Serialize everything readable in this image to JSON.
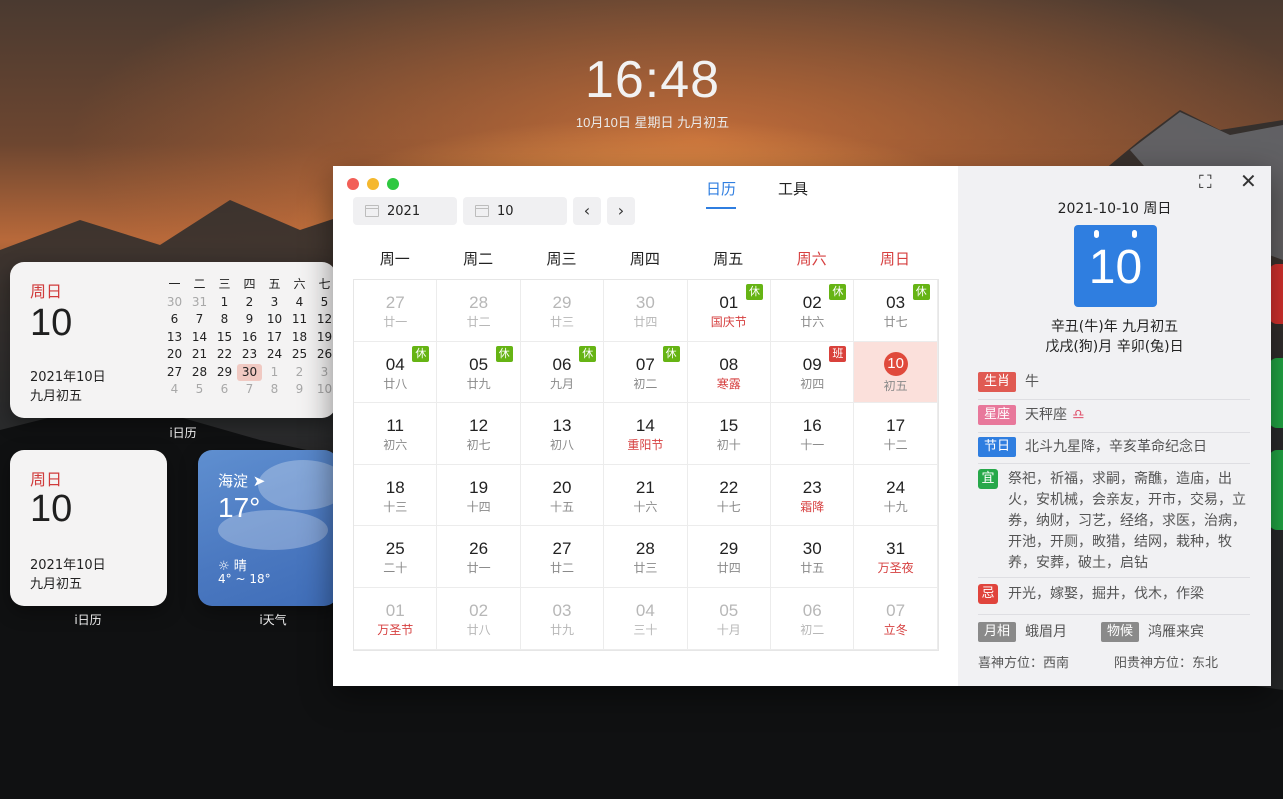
{
  "lockscreen": {
    "time": "16:48",
    "date": "10月10日 星期日 九月初五"
  },
  "widget_big": {
    "dow": "周日",
    "day": "10",
    "ymd": "2021年10日",
    "lunar": "九月初五",
    "label": "i日历",
    "weekdays": [
      "一",
      "二",
      "三",
      "四",
      "五",
      "六",
      "七"
    ],
    "rows": [
      [
        "30",
        "31",
        "1",
        "2",
        "3",
        "4",
        "5"
      ],
      [
        "6",
        "7",
        "8",
        "9",
        "10",
        "11",
        "12"
      ],
      [
        "13",
        "14",
        "15",
        "16",
        "17",
        "18",
        "19"
      ],
      [
        "20",
        "21",
        "22",
        "23",
        "24",
        "25",
        "26"
      ],
      [
        "27",
        "28",
        "29",
        "30",
        "1",
        "2",
        "3"
      ],
      [
        "4",
        "5",
        "6",
        "7",
        "8",
        "9",
        "10"
      ]
    ]
  },
  "widget_small": {
    "dow": "周日",
    "day": "10",
    "ymd": "2021年10日",
    "lunar": "九月初五",
    "label": "i日历"
  },
  "weather": {
    "location": "海淀",
    "temp": "17°",
    "condition": "☼ 晴",
    "range": "4° ~ 18°",
    "label": "i天气"
  },
  "window": {
    "year": "2021",
    "month": "10",
    "tabs": [
      "日历",
      "工具"
    ],
    "weekdays": [
      "周一",
      "周二",
      "周三",
      "周四",
      "周五",
      "周六",
      "周日"
    ],
    "cells": [
      {
        "n": "27",
        "l": "廿一",
        "dim": true
      },
      {
        "n": "28",
        "l": "廿二",
        "dim": true
      },
      {
        "n": "29",
        "l": "廿三",
        "dim": true
      },
      {
        "n": "30",
        "l": "廿四",
        "dim": true
      },
      {
        "n": "01",
        "l": "国庆节",
        "fest": true,
        "badge": "休"
      },
      {
        "n": "02",
        "l": "廿六",
        "badge": "休"
      },
      {
        "n": "03",
        "l": "廿七",
        "badge": "休"
      },
      {
        "n": "04",
        "l": "廿八",
        "badge": "休"
      },
      {
        "n": "05",
        "l": "廿九",
        "badge": "休"
      },
      {
        "n": "06",
        "l": "九月",
        "badge": "休"
      },
      {
        "n": "07",
        "l": "初二",
        "badge": "休"
      },
      {
        "n": "08",
        "l": "寒露",
        "fest": true
      },
      {
        "n": "09",
        "l": "初四",
        "badge": "班",
        "work": true
      },
      {
        "n": "10",
        "l": "初五",
        "today": true
      },
      {
        "n": "11",
        "l": "初六"
      },
      {
        "n": "12",
        "l": "初七"
      },
      {
        "n": "13",
        "l": "初八"
      },
      {
        "n": "14",
        "l": "重阳节",
        "fest": true
      },
      {
        "n": "15",
        "l": "初十"
      },
      {
        "n": "16",
        "l": "十一"
      },
      {
        "n": "17",
        "l": "十二"
      },
      {
        "n": "18",
        "l": "十三"
      },
      {
        "n": "19",
        "l": "十四"
      },
      {
        "n": "20",
        "l": "十五"
      },
      {
        "n": "21",
        "l": "十六"
      },
      {
        "n": "22",
        "l": "十七"
      },
      {
        "n": "23",
        "l": "霜降",
        "fest": true
      },
      {
        "n": "24",
        "l": "十九"
      },
      {
        "n": "25",
        "l": "二十"
      },
      {
        "n": "26",
        "l": "廿一"
      },
      {
        "n": "27",
        "l": "廿二"
      },
      {
        "n": "28",
        "l": "廿三"
      },
      {
        "n": "29",
        "l": "廿四"
      },
      {
        "n": "30",
        "l": "廿五"
      },
      {
        "n": "31",
        "l": "万圣夜",
        "fest": true
      },
      {
        "n": "01",
        "l": "万圣节",
        "fest": true,
        "dim": true
      },
      {
        "n": "02",
        "l": "廿八",
        "dim": true
      },
      {
        "n": "03",
        "l": "廿九",
        "dim": true
      },
      {
        "n": "04",
        "l": "三十",
        "dim": true
      },
      {
        "n": "05",
        "l": "十月",
        "dim": true
      },
      {
        "n": "06",
        "l": "初二",
        "dim": true
      },
      {
        "n": "07",
        "l": "立冬",
        "fest": true,
        "dim": true
      }
    ]
  },
  "panel": {
    "date": "2021-10-10 周日",
    "big_day": "10",
    "ganzhi1": "辛丑(牛)年 九月初五",
    "ganzhi2": "戊戌(狗)月 辛卯(兔)日",
    "zodiac_label": "生肖",
    "zodiac": "牛",
    "star_label": "星座",
    "star": "天秤座",
    "star_symbol": "♎",
    "holiday_label": "节日",
    "holiday": "北斗九星降，辛亥革命纪念日",
    "yi_label": "宜",
    "yi": "祭祀，祈福，求嗣，斋醮，造庙，出火，安机械，会亲友，开市，交易，立券，纳财，习艺，经络，求医，治病，开池，开厕，畋猎，结网，栽种，牧养，安葬，破土，启钻",
    "ji_label": "忌",
    "ji": "开光，嫁娶，掘井，伐木，作梁",
    "moon_label": "月相",
    "moon": "蛾眉月",
    "wuhou_label": "物候",
    "wuhou": "鸿雁来宾",
    "xishen": "喜神方位：西南",
    "yanggui": "阳贵神方位：东北"
  },
  "colors": {
    "accent": "#2f7ee0",
    "red": "#d63f3f",
    "rest": "#66b414"
  }
}
